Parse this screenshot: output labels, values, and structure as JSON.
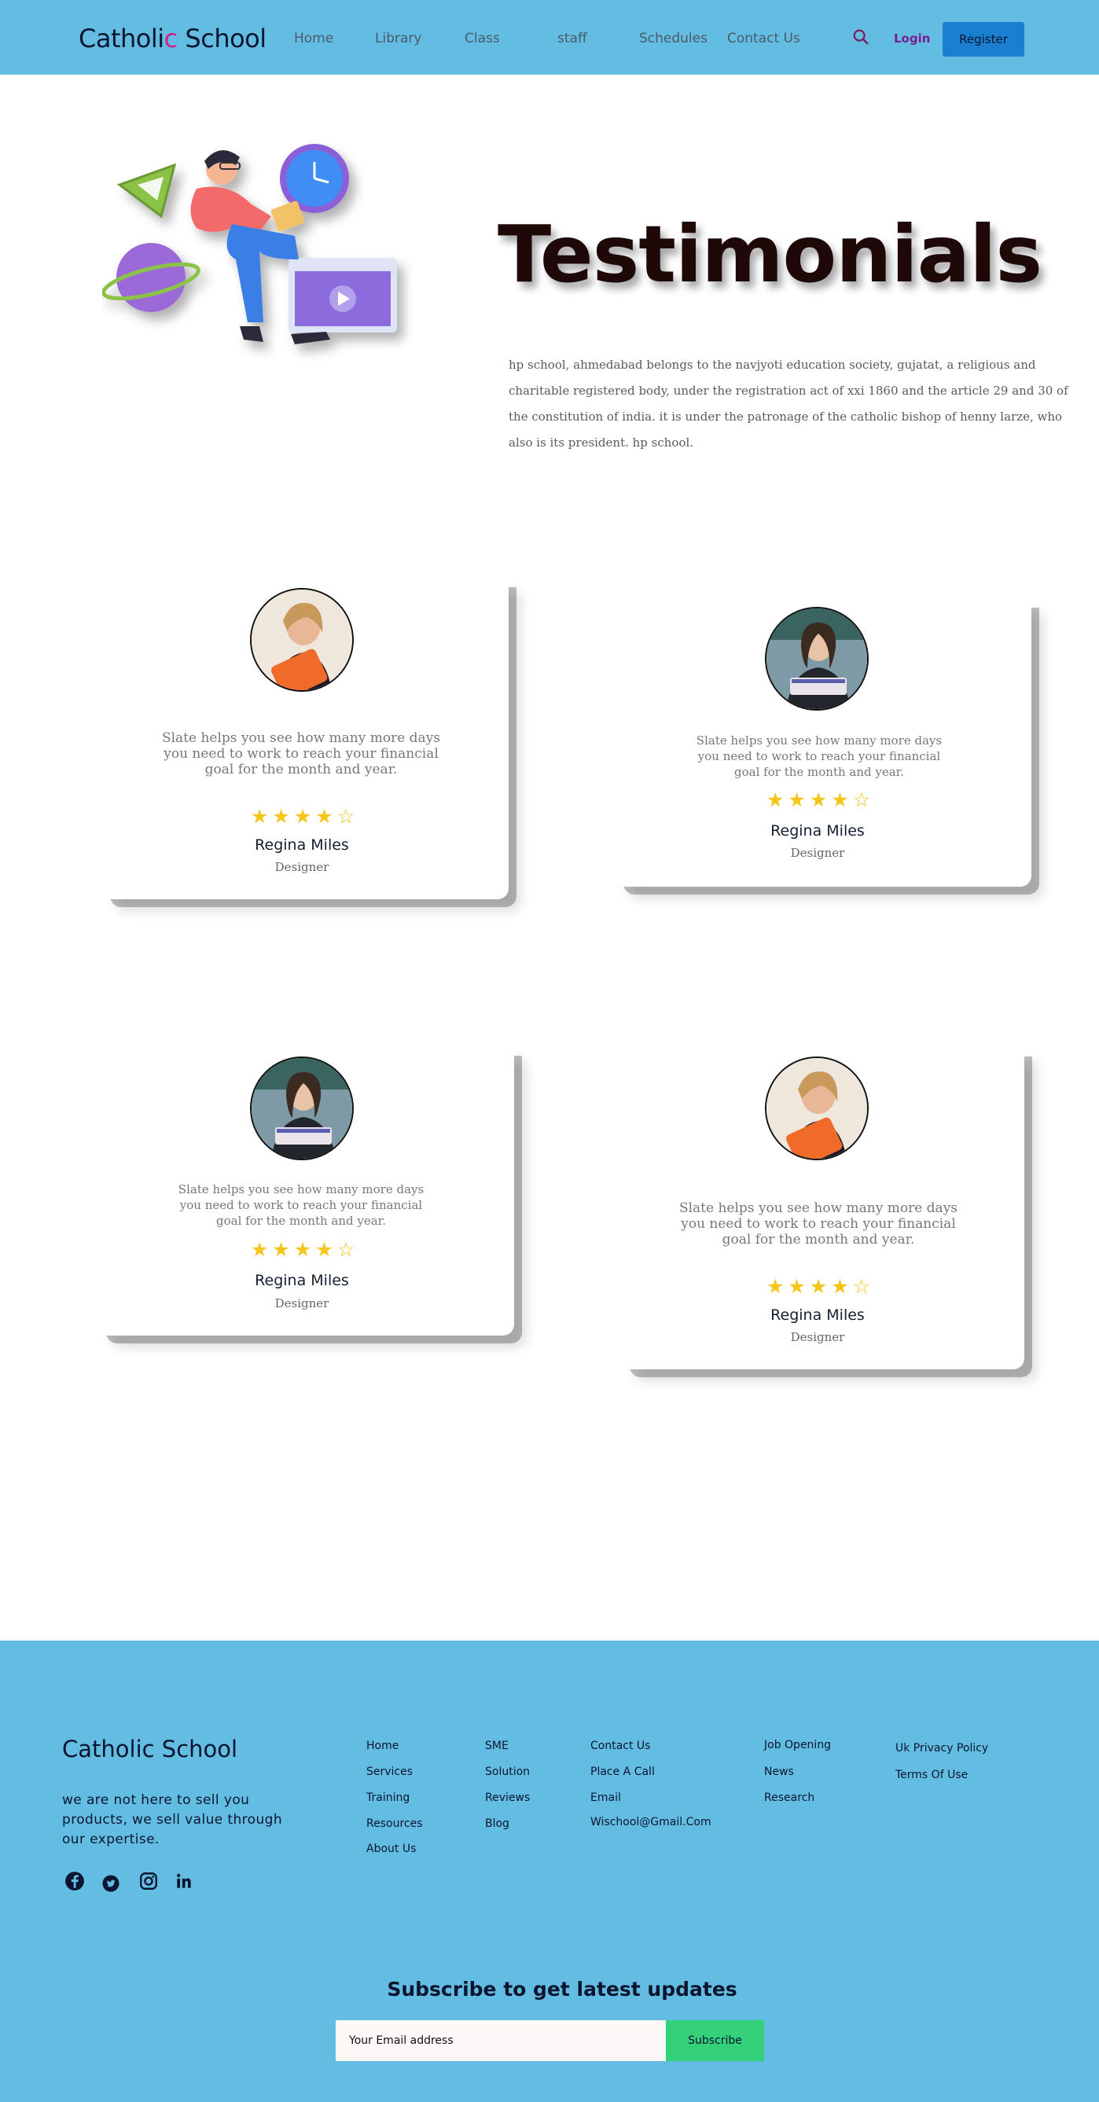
{
  "header": {
    "brand": "Catholic School",
    "nav": [
      "Home",
      "Library",
      "Class",
      "staff",
      "Schedules",
      "Contact Us"
    ],
    "login": "Login",
    "register": "Register",
    "icons": {
      "search": "search-icon"
    },
    "colors": {
      "bar": "#63bde2",
      "register_button": "#1a7fd0",
      "login": "#7a1d8f"
    }
  },
  "hero": {
    "title": "Testimonials",
    "description": "hp school, ahmedabad belongs to the navjyoti education society, gujatat, a religious and charitable registered body, under the registration act of xxi 1860 and the article 29 and 30 of the constitution of india. it is under the patronage of the catholic bishop of henny larze, who also is its president. hp school."
  },
  "testimonials": [
    {
      "quote": "Slate helps you see how many more days you need to work to reach your financial goal for the month and year.",
      "rating": 4,
      "max_rating": 5,
      "name": "Regina Miles",
      "role": "Designer"
    },
    {
      "quote": "Slate helps you see how many more days you need to work to reach your financial goal for the month and year.",
      "rating": 4,
      "max_rating": 5,
      "name": "Regina Miles",
      "role": "Designer"
    },
    {
      "quote": "Slate helps you see how many more days you need to work to reach your financial goal for the month and year.",
      "rating": 4,
      "max_rating": 5,
      "name": "Regina Miles",
      "role": "Designer"
    },
    {
      "quote": "Slate helps you see how many more days you need to work to reach your financial goal for the month and year.",
      "rating": 4,
      "max_rating": 5,
      "name": "Regina Miles",
      "role": "Designer"
    }
  ],
  "footer": {
    "brand": "Catholic School",
    "tagline": "we are not here to sell you products, we sell value through our expertise.",
    "social": [
      "facebook-icon",
      "twitter-icon",
      "instagram-icon",
      "linkedin-icon"
    ],
    "columns": [
      [
        "Home",
        "Services",
        "Training",
        "Resources",
        "About Us"
      ],
      [
        "SME",
        "Solution",
        "Reviews",
        "Blog"
      ],
      [
        "Contact Us",
        "Place A Call",
        "Email",
        "Wischool@Gmail.Com"
      ],
      [
        "Job Opening",
        "News",
        "Research"
      ],
      [
        "Uk Privacy Policy",
        "Terms Of Use"
      ]
    ],
    "subscribe_title": "Subscribe to get latest updates",
    "email_placeholder": "Your Email address",
    "subscribe_button": "Subscribe",
    "colors": {
      "background": "#63bde2",
      "subscribe_button": "#35d07a"
    }
  }
}
